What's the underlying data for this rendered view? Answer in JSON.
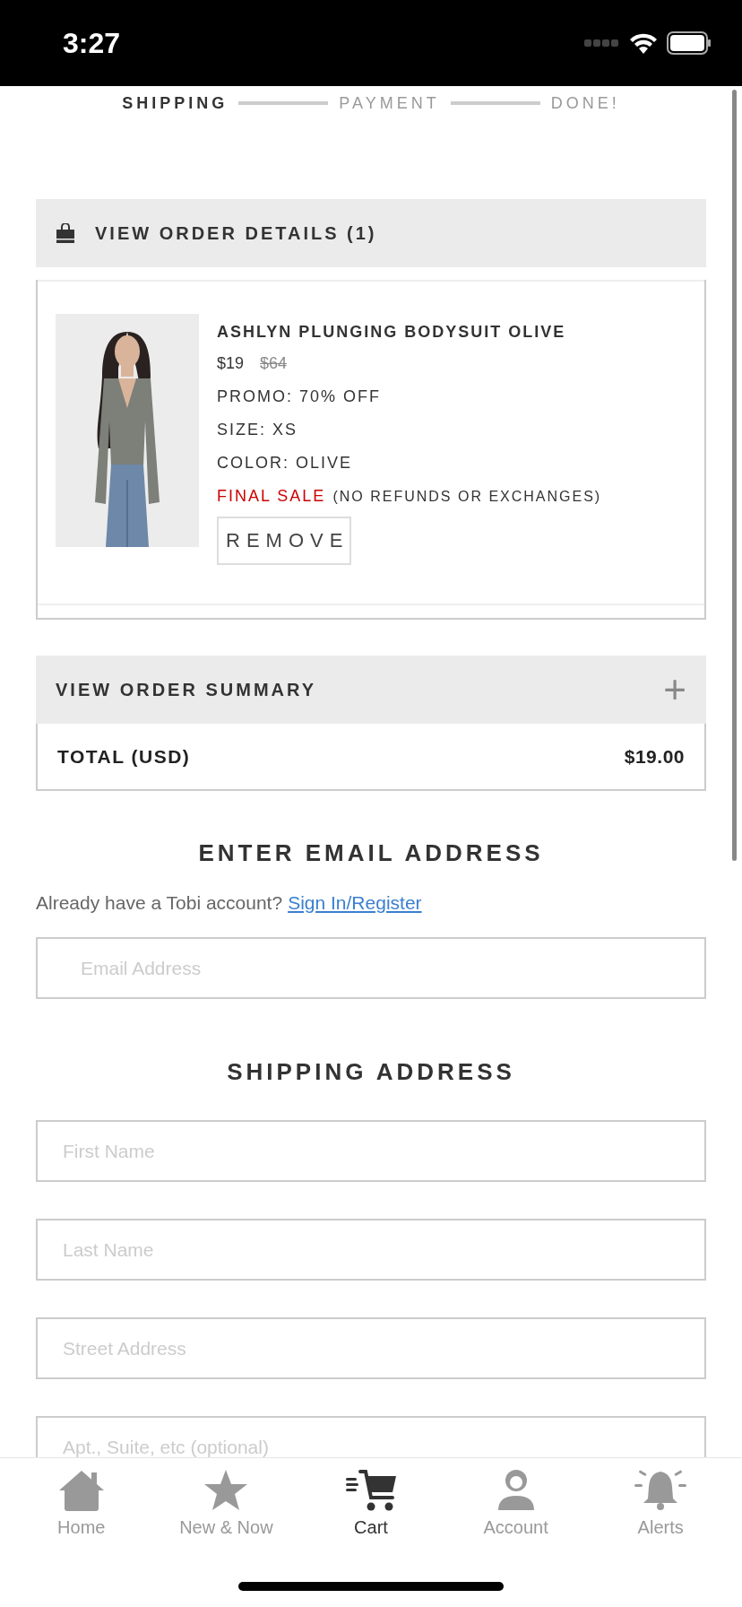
{
  "status_bar": {
    "time": "3:27"
  },
  "steps": [
    {
      "label": "SHIPPING",
      "selected": true
    },
    {
      "label": "PAYMENT",
      "selected": false
    },
    {
      "label": "DONE!",
      "selected": false
    }
  ],
  "order_details": {
    "title": "VIEW ORDER DETAILS (1)",
    "items": [
      {
        "name": "ASHLYN PLUNGING BODYSUIT OLIVE",
        "price": "$19",
        "original_price": "$64",
        "promo": "PROMO: 70% OFF",
        "size": "SIZE: XS",
        "color_text": "COLOR: OLIVE",
        "final_sale": "FINAL SALE",
        "final_sale_note": "(NO REFUNDS OR EXCHANGES)",
        "remove_button": "REMOVE"
      }
    ]
  },
  "order_summary": {
    "title": "VIEW ORDER SUMMARY",
    "expand_icon": "+",
    "total_label": "TOTAL (USD)",
    "total_value": "$19.00"
  },
  "email_section": {
    "heading": "ENTER EMAIL ADDRESS",
    "prompt": "Already have a Tobi account?",
    "link": "Sign In/Register",
    "field": {
      "placeholder": "Email Address"
    }
  },
  "shipping_section": {
    "heading": "SHIPPING ADDRESS",
    "fields": [
      {
        "placeholder": "First Name"
      },
      {
        "placeholder": "Last Name"
      },
      {
        "placeholder": "Street Address"
      },
      {
        "placeholder": "Apt., Suite, etc (optional)"
      }
    ]
  },
  "tab_bar": [
    {
      "label": "Home",
      "kind": "home",
      "selected": false
    },
    {
      "label": "New & Now",
      "kind": "star",
      "selected": false
    },
    {
      "label": "Cart",
      "kind": "cart",
      "selected": true
    },
    {
      "label": "Account",
      "kind": "person",
      "selected": false
    },
    {
      "label": "Alerts",
      "kind": "bell",
      "selected": false
    }
  ]
}
